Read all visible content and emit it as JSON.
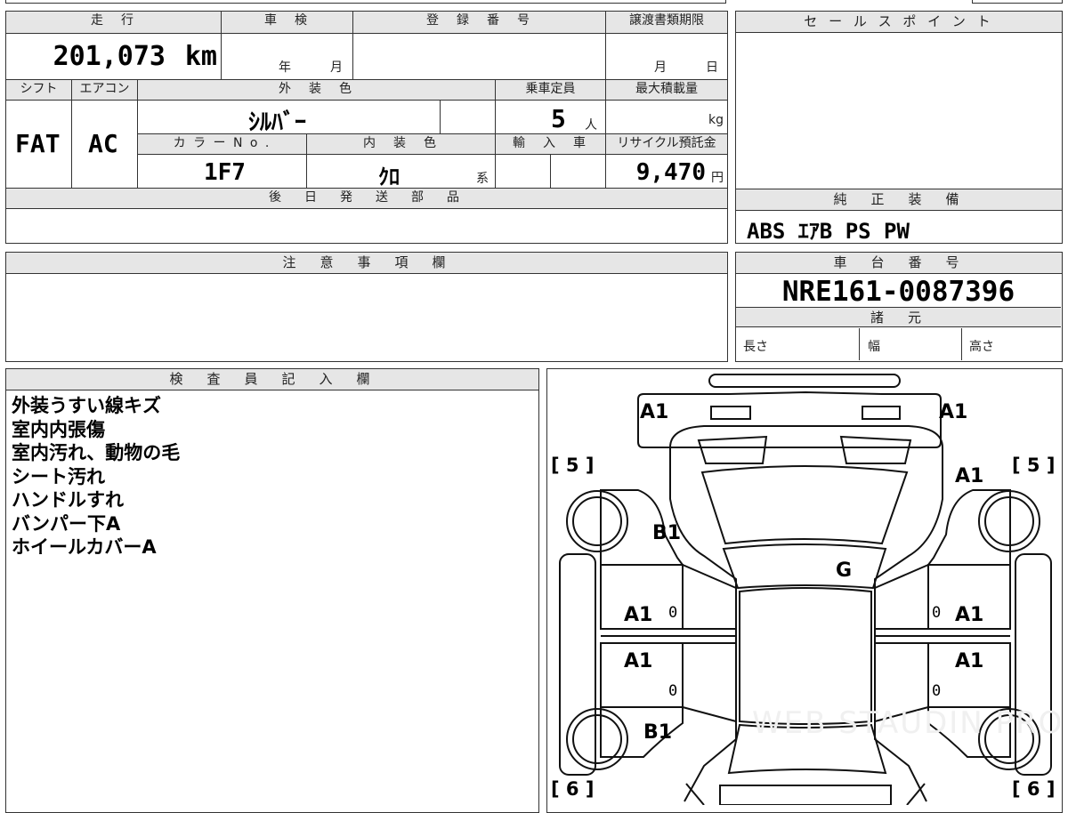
{
  "top_form": {
    "mileage_label": "走　行",
    "mileage_value": "201,073",
    "mileage_unit": "km",
    "inspection_label": "車　検",
    "inspection_year_unit": "年",
    "inspection_month_unit": "月",
    "registration_label": "登　録　番　号",
    "registration_value": "",
    "transfer_label": "譲渡書類期限",
    "transfer_month_unit": "月",
    "transfer_day_unit": "日",
    "shift_label": "シフト",
    "shift_value": "FAT",
    "ac_label": "エアコン",
    "ac_value": "AC",
    "exterior_label": "外　装　色",
    "exterior_value": "ｼﾙﾊﾞｰ",
    "capacity_label": "乗車定員",
    "capacity_value": "5",
    "capacity_unit": "人",
    "load_label": "最大積載量",
    "load_unit": "kg",
    "color_no_label": "カ ラ ー N o .",
    "color_no_value": "1F7",
    "interior_label": "内　装　色",
    "interior_value": "ｸﾛ",
    "interior_suffix": "系",
    "import_label": "輸　入　車",
    "recycle_label": "リサイクル預託金",
    "recycle_value": "9,470",
    "recycle_unit": "円",
    "later_parts_label": "後　日　発　送　部　品",
    "later_parts_value": ""
  },
  "sales_point": {
    "label": "セ ー ル ス ポ イ ン ト",
    "value": ""
  },
  "equipment": {
    "label": "純　正　装　備",
    "value": "ABS ｴｱB PS PW"
  },
  "caution": {
    "label": "注　意　事　項　欄",
    "value": ""
  },
  "chassis": {
    "label": "車　台　番　号",
    "value": "NRE161-0087396"
  },
  "specs": {
    "label": "諸　元",
    "length_label": "長さ",
    "width_label": "幅",
    "height_label": "高さ"
  },
  "inspector": {
    "label": "検　査　員　記　入　欄",
    "notes": [
      "外装うすい線キズ",
      "室内内張傷",
      "室内汚れ、動物の毛",
      "シート汚れ",
      "ハンドルすれ",
      "バンパー下A",
      "ホイールカバーA"
    ]
  },
  "diagram": {
    "marks": {
      "front_left": "A1",
      "front_right": "A1",
      "fender_right": "A1",
      "hood_left": "B1",
      "roof": "G",
      "front_door_left": "A1",
      "front_door_right": "A1",
      "rear_door_left": "A1",
      "rear_door_right": "A1",
      "rear_quarter_left": "B1",
      "tire_front_left": "[ 5 ]",
      "tire_front_right": "[ 5 ]",
      "tire_rear_left": "[ 6 ]",
      "tire_rear_right": "[ 6 ]",
      "zero_1": "0",
      "zero_2": "0",
      "zero_3": "0",
      "zero_4": "0"
    },
    "watermark": "WEB STAUDIN PRO"
  }
}
